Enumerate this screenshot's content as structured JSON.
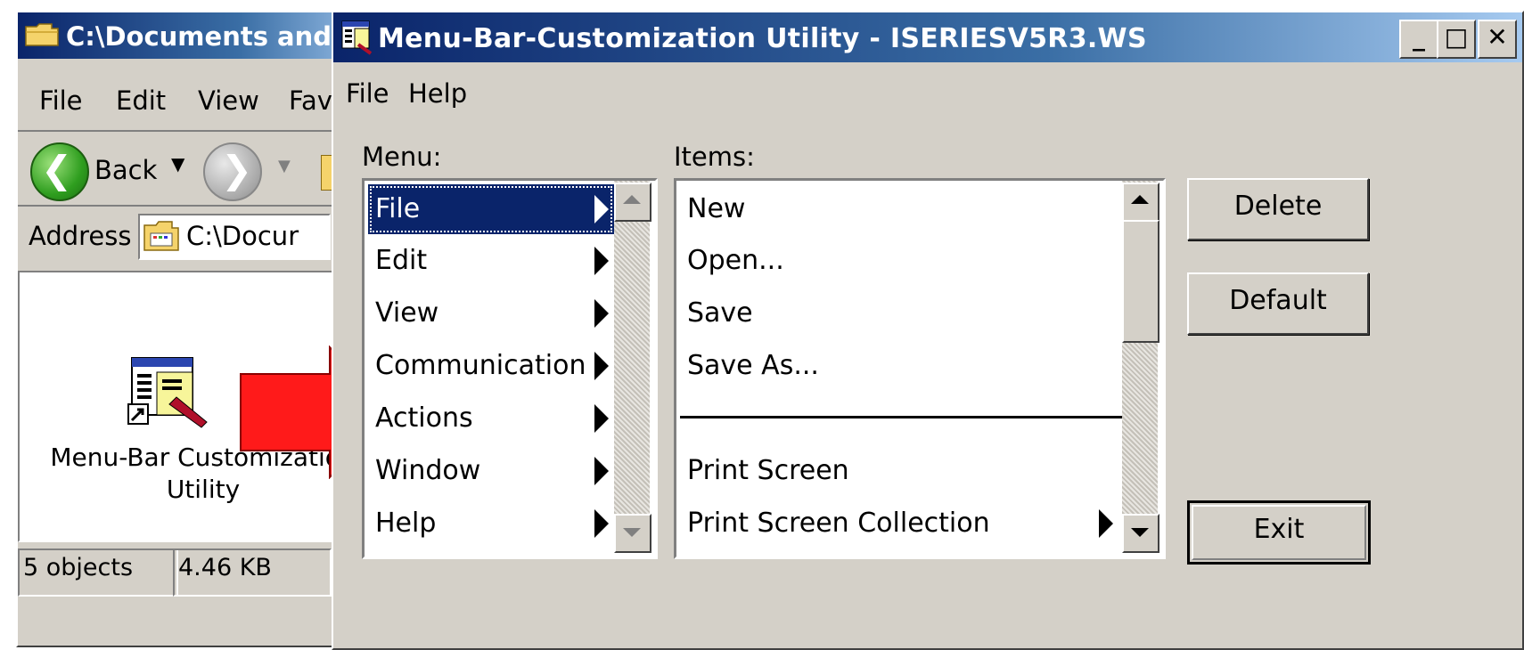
{
  "explorer": {
    "title": "C:\\Documents and ...",
    "menu": [
      "File",
      "Edit",
      "View",
      "Fav"
    ],
    "toolbar": {
      "back_label": "Back"
    },
    "address": {
      "label": "Address",
      "value": "C:\\Docur"
    },
    "desktop_item": {
      "name_line1": "Menu-Bar Customization",
      "name_line2": "Utility"
    },
    "status": {
      "objects": "5 objects",
      "size": "4.46 KB"
    }
  },
  "dialog": {
    "title": "Menu-Bar-Customization Utility - ISERIESV5R3.WS",
    "menubar": [
      "File",
      "Help"
    ],
    "menu_label": "Menu:",
    "items_label": "Items:",
    "menus": [
      {
        "label": "File",
        "selected": true
      },
      {
        "label": "Edit"
      },
      {
        "label": "View"
      },
      {
        "label": "Communication"
      },
      {
        "label": "Actions"
      },
      {
        "label": "Window"
      },
      {
        "label": "Help"
      }
    ],
    "items": [
      {
        "label": "New"
      },
      {
        "label": "Open..."
      },
      {
        "label": "Save"
      },
      {
        "label": "Save As..."
      },
      {
        "label": "Print Screen"
      },
      {
        "label": "Print Screen Collection",
        "submenu": true
      }
    ],
    "buttons": {
      "delete": "Delete",
      "default": "Default",
      "exit": "Exit"
    }
  },
  "colors": {
    "selection": "#0a246a",
    "arrow": "#ff1a1a",
    "face": "#d4d0c8"
  }
}
